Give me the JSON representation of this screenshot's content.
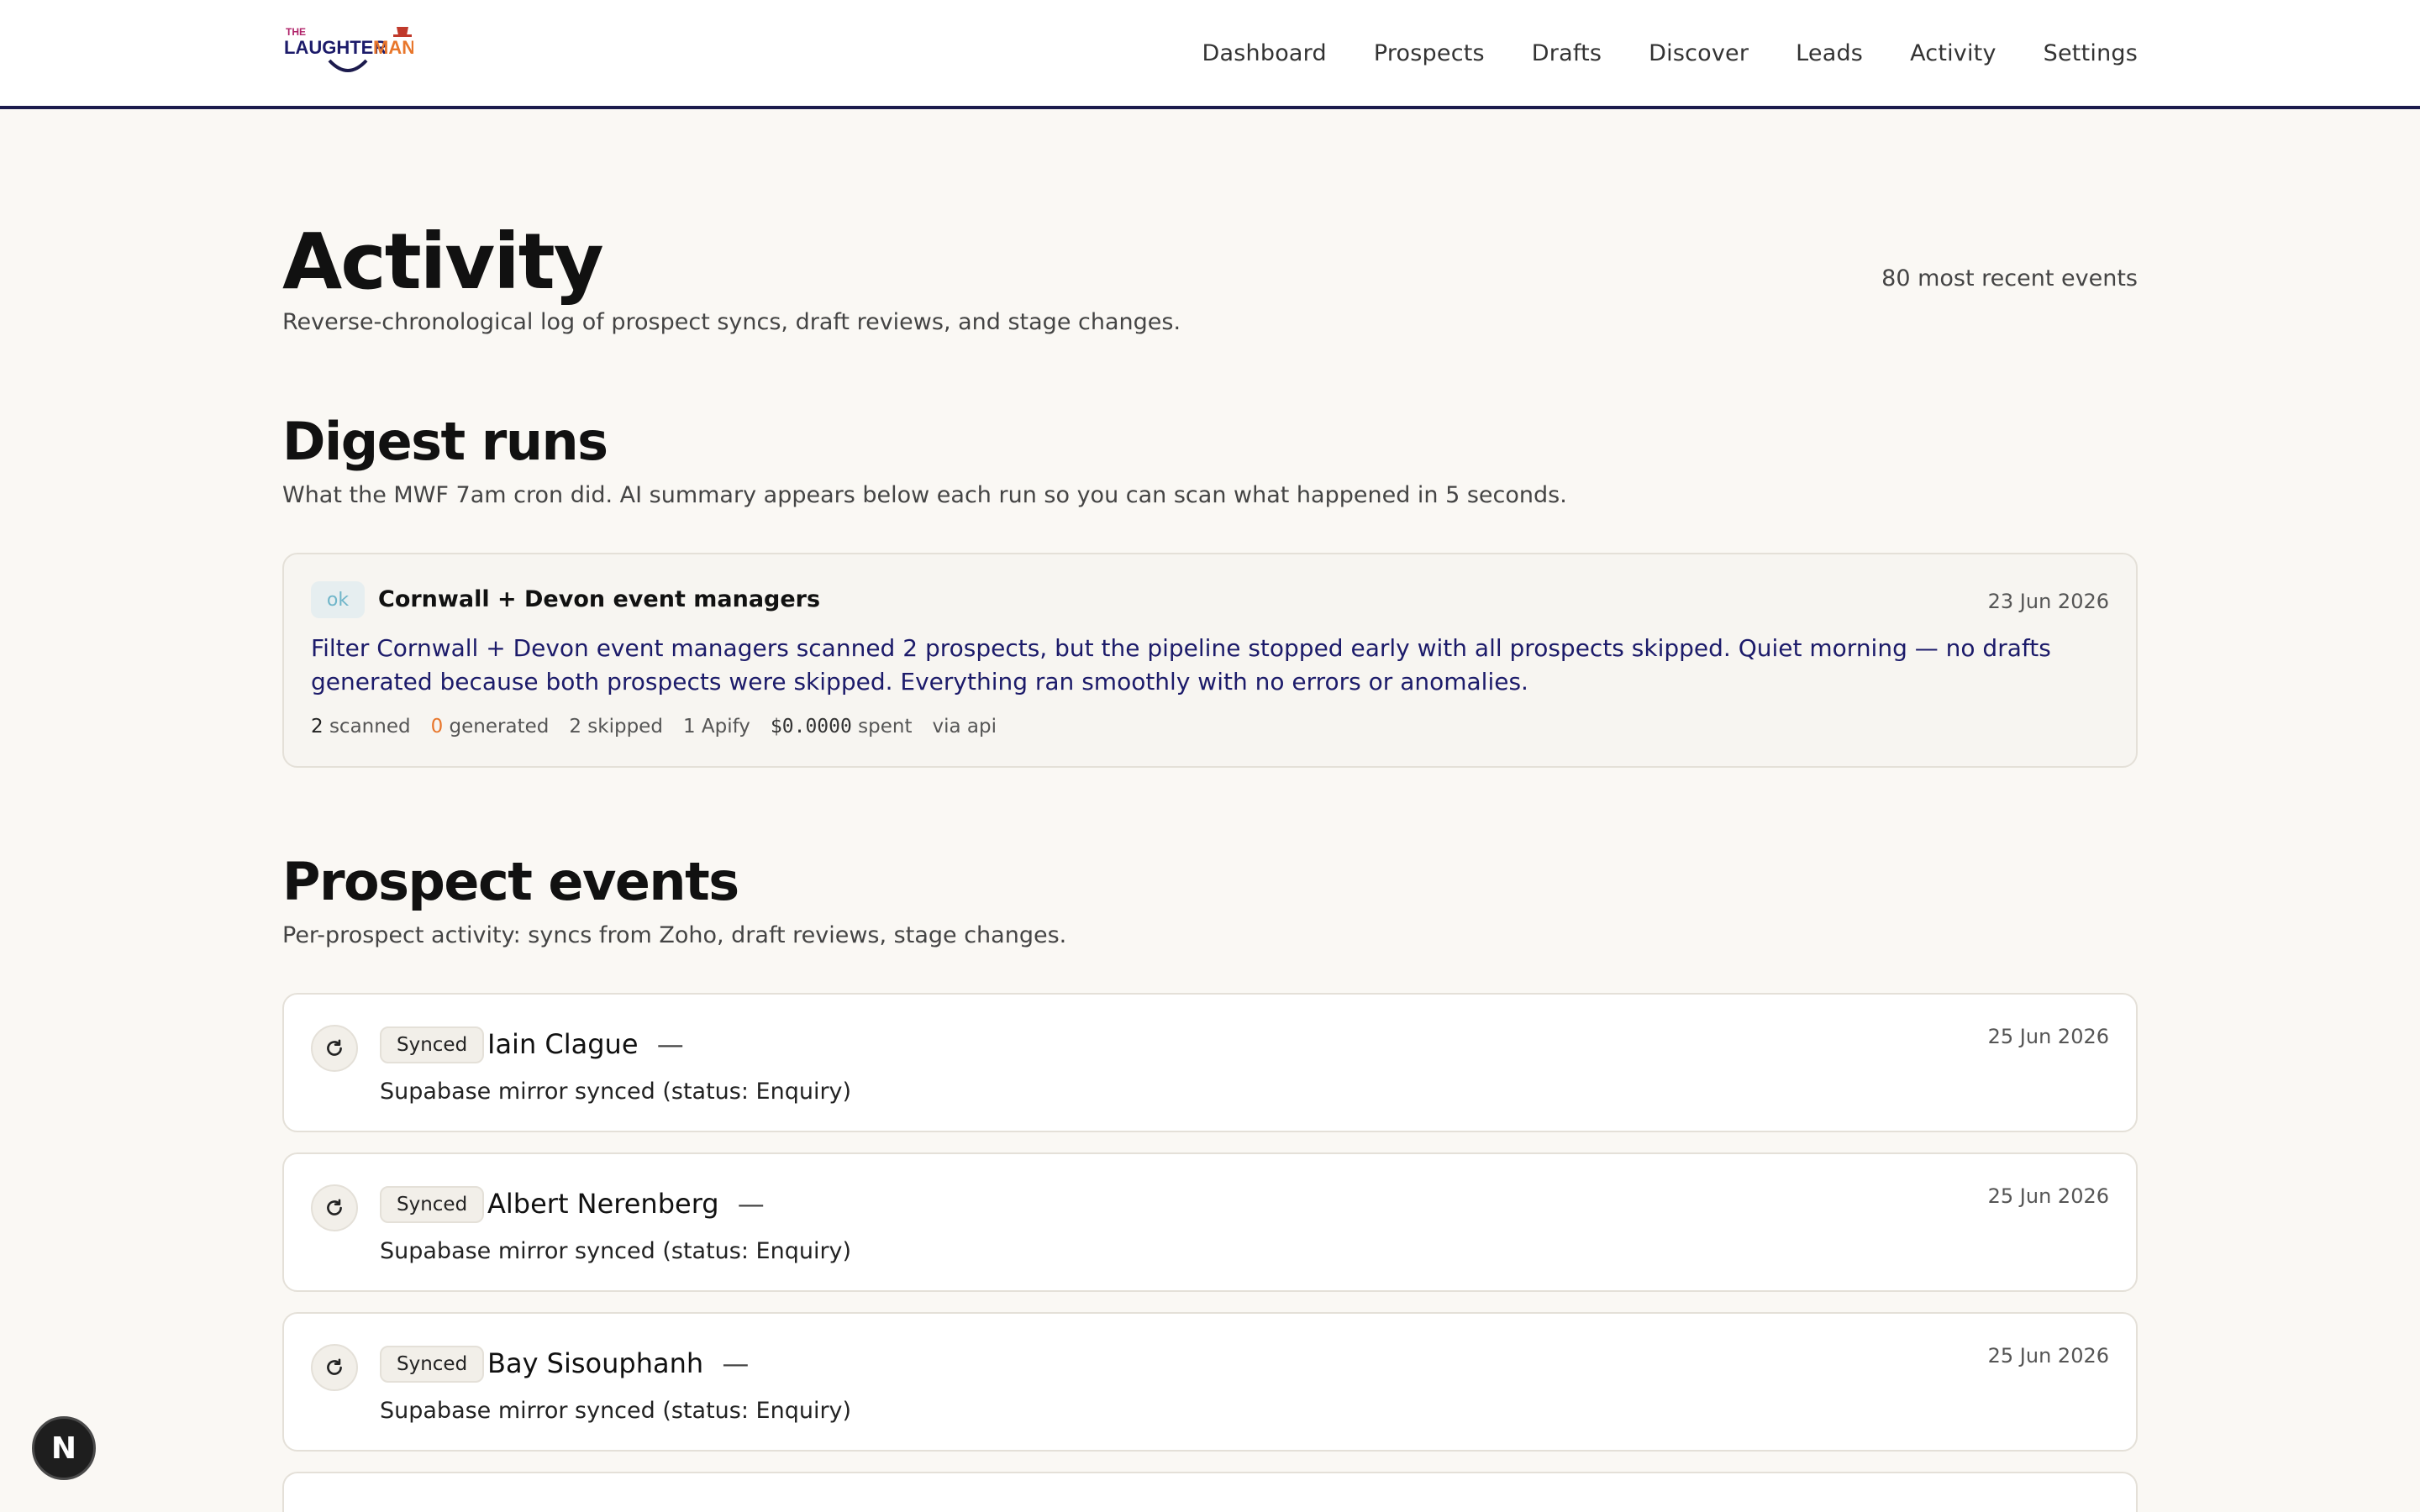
{
  "brand": {
    "logo_top": "THE",
    "logo_main": "LAUGHTER",
    "logo_accent": "MAN"
  },
  "nav": {
    "items": [
      {
        "label": "Dashboard"
      },
      {
        "label": "Prospects"
      },
      {
        "label": "Drafts"
      },
      {
        "label": "Discover"
      },
      {
        "label": "Leads"
      },
      {
        "label": "Activity"
      },
      {
        "label": "Settings"
      }
    ]
  },
  "page": {
    "title": "Activity",
    "subtitle": "Reverse-chronological log of prospect syncs, draft reviews, and stage changes.",
    "recent_count": "80 most recent events"
  },
  "digest": {
    "title": "Digest runs",
    "subtitle": "What the MWF 7am cron did. AI summary appears below each run so you can scan what happened in 5 seconds.",
    "runs": [
      {
        "status": "ok",
        "name": "Cornwall + Devon event managers",
        "date": "23 Jun 2026",
        "summary": "Filter Cornwall + Devon event managers scanned 2 prospects, but the pipeline stopped early with all prospects skipped. Quiet morning — no drafts generated because both prospects were skipped. Everything ran smoothly with no errors or anomalies.",
        "scanned_num": "2",
        "scanned_label": "scanned",
        "generated_num": "0",
        "generated_label": "generated",
        "skipped": "2 skipped",
        "apify": "1 Apify",
        "spent_num": "$0.0000",
        "spent_label": "spent",
        "via": "via api"
      }
    ]
  },
  "events": {
    "title": "Prospect events",
    "subtitle": "Per-prospect activity: syncs from Zoho, draft reviews, stage changes.",
    "items": [
      {
        "badge": "Synced",
        "name": "Iain Clague",
        "dash": "—",
        "desc": "Supabase mirror synced (status: Enquiry)",
        "date": "25 Jun 2026"
      },
      {
        "badge": "Synced",
        "name": "Albert Nerenberg",
        "dash": "—",
        "desc": "Supabase mirror synced (status: Enquiry)",
        "date": "25 Jun 2026"
      },
      {
        "badge": "Synced",
        "name": "Bay Sisouphanh",
        "dash": "—",
        "desc": "Supabase mirror synced (status: Enquiry)",
        "date": "25 Jun 2026"
      }
    ]
  },
  "dev_fab": {
    "label": "N"
  },
  "colors": {
    "nav_border": "#1c1b4d",
    "summary_text": "#1c1b6a",
    "ok_badge_text": "#6fb5c9",
    "generated_accent": "#e8762b"
  },
  "icons": {
    "sync": "refresh-icon"
  }
}
